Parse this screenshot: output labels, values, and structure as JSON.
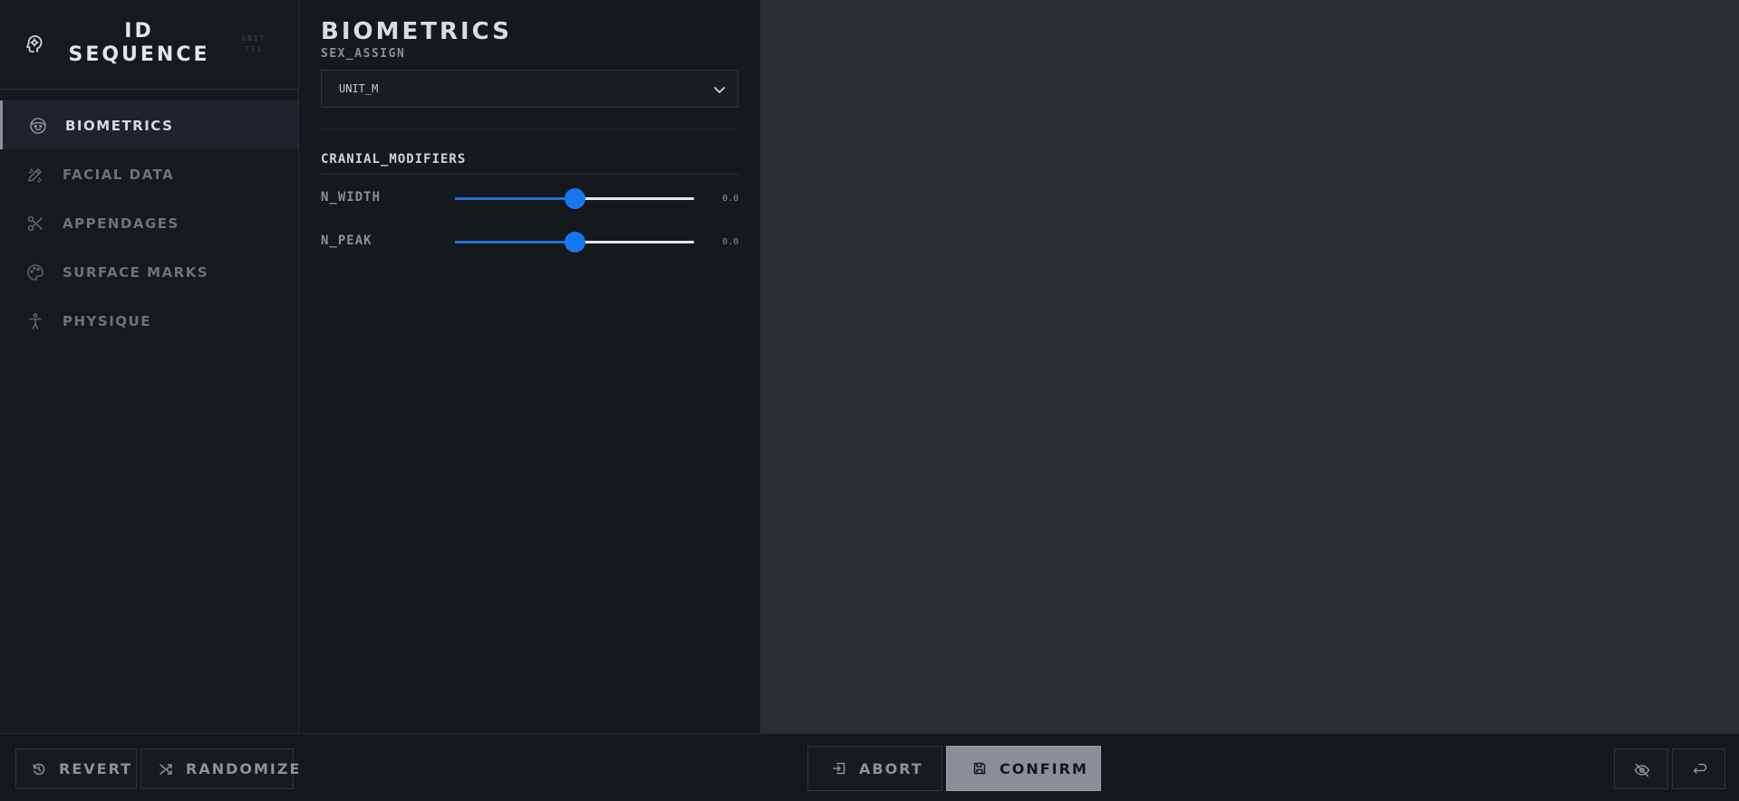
{
  "brand": {
    "title": "ID SEQUENCE",
    "unit": "UNIT 731",
    "icon": "head-gear-icon"
  },
  "sidebar": {
    "items": [
      {
        "label": "BIOMETRICS",
        "icon": "face-icon",
        "active": true
      },
      {
        "label": "FACIAL DATA",
        "icon": "pencil-ruler-icon",
        "active": false
      },
      {
        "label": "APPENDAGES",
        "icon": "scissors-icon",
        "active": false
      },
      {
        "label": "SURFACE MARKS",
        "icon": "palette-icon",
        "active": false
      },
      {
        "label": "PHYSIQUE",
        "icon": "person-icon",
        "active": false
      }
    ]
  },
  "panel": {
    "title": "BIOMETRICS",
    "sex_label": "SEX_ASSIGN",
    "sex_value": "UNIT_M",
    "section_title": "CRANIAL_MODIFIERS",
    "sliders": [
      {
        "label": "N_WIDTH",
        "value": "0.0",
        "position": 0.5
      },
      {
        "label": "N_PEAK",
        "value": "0.0",
        "position": 0.5
      }
    ]
  },
  "footer": {
    "revert_label": "REVERT",
    "randomize_label": "RANDOMIZE",
    "abort_label": "ABORT",
    "confirm_label": "CONFIRM",
    "hide_icon": "eye-off-icon",
    "undo_icon": "undo-icon"
  },
  "colors": {
    "accent": "#1577f0",
    "confirm_bg": "#8a8f96",
    "viewport_bg": "#2b2e32",
    "panel_bg": "#15181d"
  }
}
